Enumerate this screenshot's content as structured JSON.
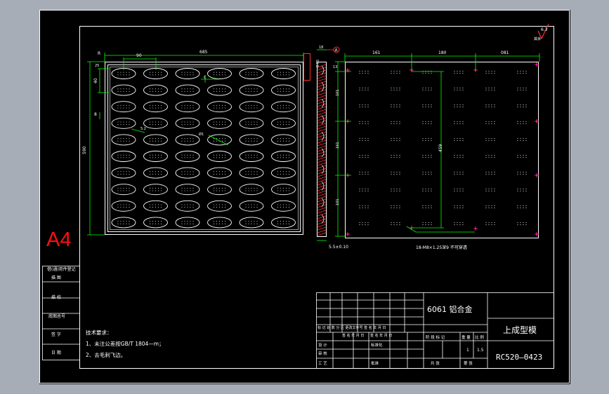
{
  "sheet": {
    "size_tag": "A4",
    "surface_mark": "6.3",
    "colors": {
      "background": "#000000",
      "frame": "#ffffff",
      "part_outline": "#ffffff",
      "dimension": "#00ff00",
      "hatch": "#ff3030",
      "size_tag": "#ff1010",
      "magenta_marker": "#ff00ff",
      "outer_margin": "#a7adb6"
    }
  },
  "plan_view": {
    "dim_total_width": "685",
    "dim_pitch_x": "90",
    "dim_overall_height": "590",
    "dim_edge_top": "25",
    "dim_pitch_y": "40",
    "dim_row_gap": "8",
    "dim_corner_r": "R",
    "note_slot": "5.2",
    "note_hole": "Ø1",
    "note_cut": "C"
  },
  "section_view": {
    "dim_thickness": "18",
    "section_mark": "A",
    "tolerance_label": "0.05",
    "bottom_dim": "5.5±0.10"
  },
  "back_view": {
    "dim_left": "161",
    "dim_mid": "180",
    "dim_right": "081",
    "dim_v_top": "13",
    "dim_v1": "101",
    "dim_v2": "161",
    "dim_v3": "101",
    "dim_height": "459",
    "callout": "18-M8×1.25深9 不可穿透"
  },
  "side_panel": {
    "rows": [
      "借(通)用件登记",
      "描    图",
      "描    校",
      "底图总号",
      "签    字",
      "日    期"
    ]
  },
  "tech_requirements": {
    "title": "技术要求：",
    "items": [
      "1、未注公差按GB/T 1804—m；",
      "2、去毛刺飞边。"
    ]
  },
  "title_block": {
    "material": "6061  铝合金",
    "part_name": "上成型模",
    "drawing_no": "RC520—0423",
    "change_header": "标 记 处 数  分   区 更改文件号  签  名  年  月  日",
    "sign_header": "设计",
    "sign_row_labels": [
      "设 计",
      "审 核",
      "工 艺"
    ],
    "standardization": "标准化",
    "approve": "批准",
    "sig_header_a": "签  名  年  月  日",
    "sig_header_b": "签  名  年  月  日",
    "stage_header": "阶  段  标  记",
    "weight_header": "重  量",
    "scale_header": "比  例",
    "scale_num": "1",
    "scale_value": "1.5",
    "sheets_total": "共    张",
    "sheet_no": "第    张"
  }
}
